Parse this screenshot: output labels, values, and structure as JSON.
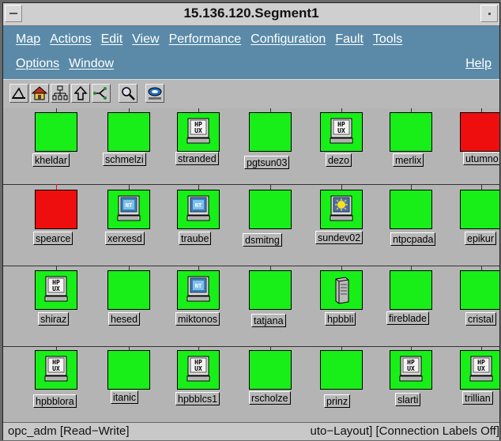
{
  "window": {
    "title": "15.136.120.Segment1"
  },
  "menu": {
    "row1": [
      "Map",
      "Actions",
      "Edit",
      "View",
      "Performance",
      "Configuration",
      "Fault",
      "Tools"
    ],
    "row2": [
      "Options",
      "Window"
    ],
    "help": "Help"
  },
  "toolbar": {
    "tools": [
      "triangle-tool-icon",
      "home-icon",
      "hierarchy-icon",
      "up-arrow-icon",
      "network-icon",
      "search-icon",
      "hp-openview-icon"
    ]
  },
  "nodes": [
    {
      "label": "kheldar",
      "status": "green",
      "icon": "none"
    },
    {
      "label": "schmelzi",
      "status": "green",
      "icon": "none"
    },
    {
      "label": "stranded",
      "status": "green",
      "icon": "hpux"
    },
    {
      "label": "pgtsun03",
      "status": "green",
      "icon": "none"
    },
    {
      "label": "dezo",
      "status": "green",
      "icon": "hpux"
    },
    {
      "label": "merlix",
      "status": "green",
      "icon": "none"
    },
    {
      "label": "utumno",
      "status": "red",
      "icon": "none"
    },
    {
      "label": "spearce",
      "status": "red",
      "icon": "none"
    },
    {
      "label": "xerxesd",
      "status": "green",
      "icon": "nt"
    },
    {
      "label": "traube",
      "status": "green",
      "icon": "nt"
    },
    {
      "label": "dsmitng",
      "status": "green",
      "icon": "none"
    },
    {
      "label": "sundev02",
      "status": "green",
      "icon": "sun"
    },
    {
      "label": "ntpcpada",
      "status": "green",
      "icon": "none"
    },
    {
      "label": "epikur",
      "status": "green",
      "icon": "none"
    },
    {
      "label": "shiraz",
      "status": "green",
      "icon": "hpux"
    },
    {
      "label": "hesed",
      "status": "green",
      "icon": "none"
    },
    {
      "label": "miktonos",
      "status": "green",
      "icon": "nt"
    },
    {
      "label": "tatjana",
      "status": "green",
      "icon": "none"
    },
    {
      "label": "hpbbli",
      "status": "green",
      "icon": "server"
    },
    {
      "label": "fireblade",
      "status": "green",
      "icon": "none"
    },
    {
      "label": "cristal",
      "status": "green",
      "icon": "none"
    },
    {
      "label": "hpbblora",
      "status": "green",
      "icon": "hpux"
    },
    {
      "label": "itanic",
      "status": "green",
      "icon": "none"
    },
    {
      "label": "hpbblcs1",
      "status": "green",
      "icon": "hpux"
    },
    {
      "label": "rscholze",
      "status": "green",
      "icon": "none"
    },
    {
      "label": "prinz",
      "status": "green",
      "icon": "none"
    },
    {
      "label": "slarti",
      "status": "green",
      "icon": "hpux"
    },
    {
      "label": "trillian",
      "status": "green",
      "icon": "hpux"
    }
  ],
  "status": {
    "left": "opc_adm [Read−Write]",
    "right": "uto−Layout] [Connection Labels Off]"
  },
  "colors": {
    "node_up": "#18ef18",
    "node_down": "#ee0e0e",
    "menu_bg": "#5a8aa8"
  }
}
